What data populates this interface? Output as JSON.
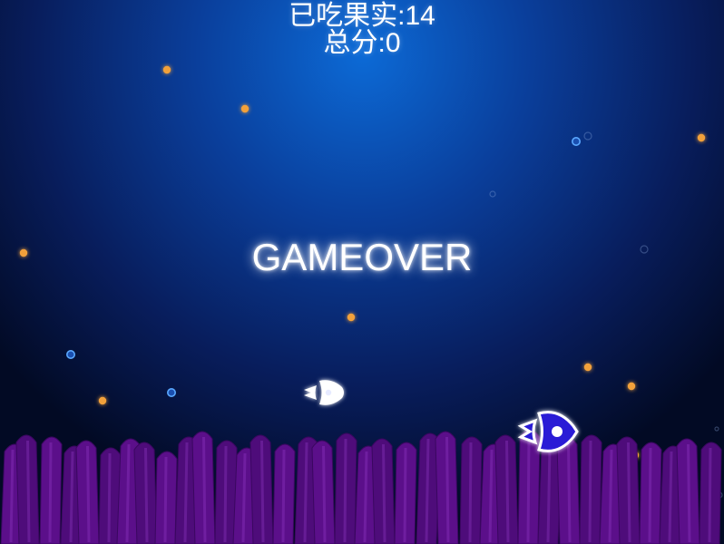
{
  "hud": {
    "fruits_label": "已吃果实:",
    "fruits_value": "14",
    "score_label": "总分:",
    "score_value": "0"
  },
  "overlay": {
    "gameover_text": "GAMEOVER"
  },
  "colors": {
    "sea_top": "#0c6ad6",
    "sea_mid": "#0b2a6e",
    "sea_deep": "#020a24",
    "anemone": "#5a0f88",
    "anemone_light": "#7a1aa8",
    "orange_fruit": "#f2a13a",
    "blue_fruit": "#5aa8ff",
    "baby_fish": "#ffffff",
    "player_fish_body": "#2a1ad6",
    "player_fish_outline": "#ffffff"
  },
  "icons": {
    "fruit_orange": "orange-fruit-icon",
    "fruit_blue": "blue-fruit-icon",
    "baby_fish": "baby-fish-icon",
    "player_fish": "player-fish-icon",
    "anemone": "anemone-icon",
    "bubble": "bubble-icon"
  }
}
